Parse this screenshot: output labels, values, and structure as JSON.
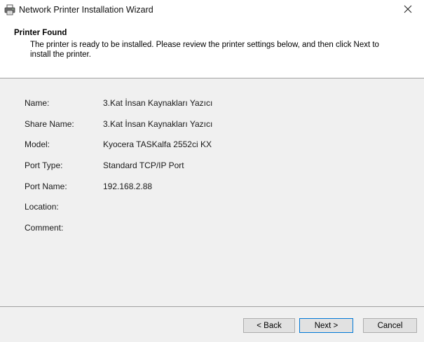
{
  "window": {
    "title": "Network Printer Installation Wizard",
    "icon": "printer-icon",
    "close_icon": "close-icon"
  },
  "header": {
    "title": "Printer Found",
    "description": "The printer is ready to be installed. Please review the printer settings below, and then click Next to install the printer."
  },
  "details": [
    {
      "label": "Name:",
      "value": "3.Kat İnsan Kaynakları Yazıcı"
    },
    {
      "label": "Share Name:",
      "value": "3.Kat İnsan Kaynakları Yazıcı"
    },
    {
      "label": "Model:",
      "value": "Kyocera TASKalfa 2552ci KX"
    },
    {
      "label": "Port Type:",
      "value": "Standard TCP/IP Port"
    },
    {
      "label": "Port Name:",
      "value": "192.168.2.88"
    },
    {
      "label": "Location:",
      "value": ""
    },
    {
      "label": "Comment:",
      "value": ""
    }
  ],
  "buttons": {
    "back": "< Back",
    "next": "Next >",
    "cancel": "Cancel"
  },
  "colors": {
    "content_bg": "#f0f0f0",
    "accent_focus": "#0078d7",
    "button_bg": "#e1e1e1"
  }
}
